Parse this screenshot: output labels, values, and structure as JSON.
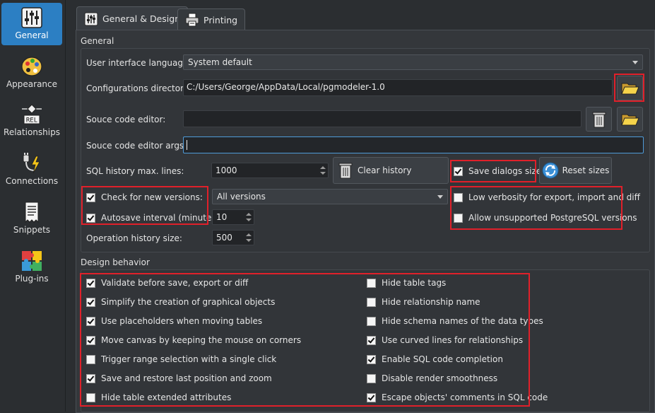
{
  "sidebar": {
    "items": [
      {
        "label": "General",
        "icon": "sliders-icon",
        "active": true
      },
      {
        "label": "Appearance",
        "icon": "palette-icon",
        "active": false
      },
      {
        "label": "Relationships",
        "icon": "relationship-icon",
        "active": false
      },
      {
        "label": "Connections",
        "icon": "plug-icon",
        "active": false
      },
      {
        "label": "Snippets",
        "icon": "snippet-icon",
        "active": false
      },
      {
        "label": "Plug-ins",
        "icon": "puzzle-icon",
        "active": false
      }
    ]
  },
  "tabs": [
    {
      "label": "General & Design",
      "icon": "settings-tab-icon",
      "active": true
    },
    {
      "label": "Printing",
      "icon": "printer-icon",
      "active": false
    }
  ],
  "general": {
    "title": "General",
    "ui_language_label": "User interface language:",
    "ui_language_value": "System default",
    "config_dir_label": "Configurations directory:",
    "config_dir_value": "C:/Users/George/AppData/Local/pgmodeler-1.0",
    "source_editor_label": "Souce code editor:",
    "source_editor_value": "",
    "source_editor_args_label": "Souce code editor args:",
    "source_editor_args_value": "",
    "sql_history_label": "SQL history max. lines:",
    "sql_history_value": "1000",
    "clear_history_label": "Clear history",
    "save_dialogs_label": "Save dialogs sizes",
    "save_dialogs_checked": true,
    "reset_sizes_label": "Reset sizes",
    "check_versions_label": "Check for new versions:",
    "check_versions_checked": true,
    "versions_value": "All versions",
    "autosave_label": "Autosave interval (minutes):",
    "autosave_checked": true,
    "autosave_value": "10",
    "op_history_label": "Operation history size:",
    "op_history_value": "500",
    "low_verbosity_label": "Low verbosity for export, import and diff",
    "low_verbosity_checked": false,
    "allow_unsupported_label": "Allow unsupported PostgreSQL versions",
    "allow_unsupported_checked": false
  },
  "design": {
    "title": "Design behavior",
    "left": [
      {
        "label": "Validate before save, export or diff",
        "checked": true
      },
      {
        "label": "Simplify the creation of graphical objects",
        "checked": true
      },
      {
        "label": "Use placeholders when moving tables",
        "checked": true
      },
      {
        "label": "Move canvas by keeping the mouse on corners",
        "checked": true
      },
      {
        "label": "Trigger range selection with a single click",
        "checked": false
      },
      {
        "label": "Save and restore last position and zoom",
        "checked": true
      },
      {
        "label": "Hide table extended attributes",
        "checked": false
      }
    ],
    "right": [
      {
        "label": "Hide table tags",
        "checked": false
      },
      {
        "label": "Hide relationship name",
        "checked": false
      },
      {
        "label": "Hide schema names of the data types",
        "checked": false
      },
      {
        "label": "Use curved lines for relationships",
        "checked": true
      },
      {
        "label": "Enable SQL code completion",
        "checked": true
      },
      {
        "label": "Disable render smoothness",
        "checked": false
      },
      {
        "label": "Escape objects' comments in SQL code",
        "checked": true
      }
    ]
  },
  "colors": {
    "accent": "#2c7fc3",
    "highlight": "#e0202a"
  }
}
